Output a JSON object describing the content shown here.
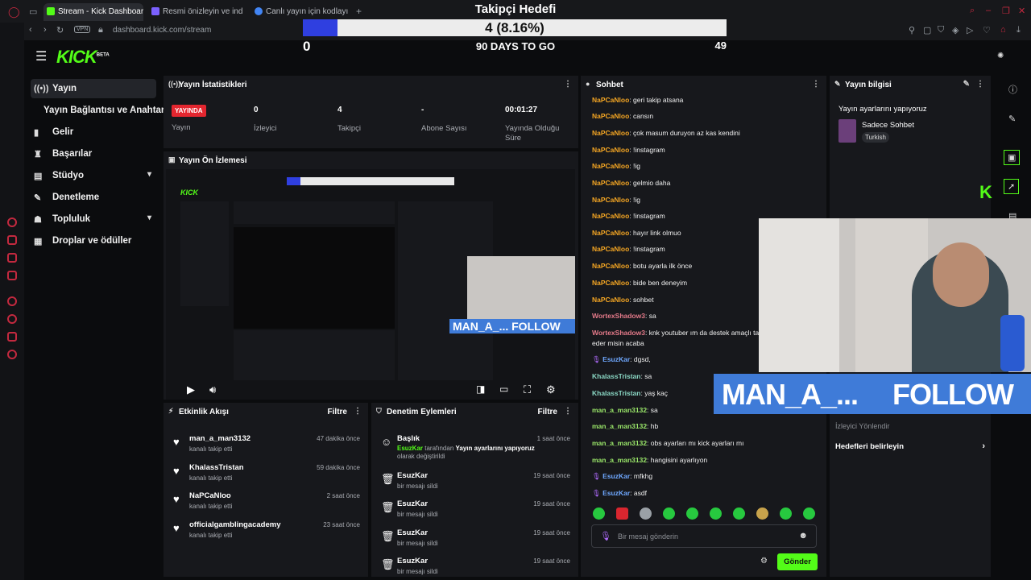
{
  "browser": {
    "tabs": [
      {
        "label": "Stream - Kick Dashboard",
        "color": "#53fc18"
      },
      {
        "label": "Resmi önizleyin ve indirin",
        "color": "#7b61ff"
      },
      {
        "label": "Canlı yayın için kodlayıcı a",
        "color": "#4285f4"
      }
    ],
    "new_tab": "+",
    "url": "dashboard.kick.com/stream",
    "vpn": "VPN"
  },
  "goal_overlay": {
    "title": "Takipçi Hedefi",
    "value_text": "4 (8.16%)",
    "progress_percent": 8.16,
    "min": "0",
    "days": "90 DAYS TO GO",
    "max": "49"
  },
  "app": {
    "logo": "KICK",
    "logo_badge": "BETA"
  },
  "sidebar": {
    "items": [
      {
        "label": "Yayın",
        "icon": "broadcast-icon",
        "active": true
      },
      {
        "label": "Yayın Bağlantısı ve Anahtarı",
        "icon": ""
      },
      {
        "label": "Gelir",
        "icon": "chart-icon"
      },
      {
        "label": "Başarılar",
        "icon": "trophy-icon"
      },
      {
        "label": "Stüdyo",
        "icon": "studio-icon",
        "chevron": true
      },
      {
        "label": "Denetleme",
        "icon": "wrench-icon"
      },
      {
        "label": "Topluluk",
        "icon": "community-icon",
        "chevron": true
      },
      {
        "label": "Droplar ve ödüller",
        "icon": "gift-icon"
      }
    ]
  },
  "stats_panel": {
    "title": "Yayın İstatistikleri",
    "live_badge": "YAYINDA",
    "items": [
      {
        "value": "",
        "label": "Yayın"
      },
      {
        "value": "0",
        "label": "İzleyici"
      },
      {
        "value": "4",
        "label": "Takipçi"
      },
      {
        "value": "-",
        "label": "Abone Sayısı"
      },
      {
        "value": "00:01:27",
        "label": "Yayında Olduğu Süre"
      }
    ]
  },
  "preview_panel": {
    "title": "Yayın Ön İzlemesi",
    "nested_banner": "MAN_A_...  FOLLOW"
  },
  "activity_panel": {
    "title": "Etkinlik Akışı",
    "filter": "Filtre",
    "items": [
      {
        "name": "man_a_man3132",
        "desc": "kanalı takip etti",
        "time": "47 dakika önce"
      },
      {
        "name": "KhalassTristan",
        "desc": "kanalı takip etti",
        "time": "59 dakika önce"
      },
      {
        "name": "NaPCaNloo",
        "desc": "kanalı takip etti",
        "time": "2 saat önce"
      },
      {
        "name": "officialgamblingacademy",
        "desc": "kanalı takip etti",
        "time": "23 saat önce"
      }
    ]
  },
  "moderation_panel": {
    "title": "Denetim Eylemleri",
    "filter": "Filtre",
    "first": {
      "name": "Başlık",
      "user": "EsuzKar",
      "mid": " tarafından ",
      "value": "Yayın ayarlarını yapıyoruz",
      "end": " olarak değiştirildi",
      "time": "1 saat önce"
    },
    "items": [
      {
        "name": "EsuzKar",
        "desc": "bir mesajı sildi",
        "time": "19 saat önce"
      },
      {
        "name": "EsuzKar",
        "desc": "bir mesajı sildi",
        "time": "19 saat önce"
      },
      {
        "name": "EsuzKar",
        "desc": "bir mesajı sildi",
        "time": "19 saat önce"
      },
      {
        "name": "EsuzKar",
        "desc": "bir mesajı sildi",
        "time": "19 saat önce"
      }
    ]
  },
  "chat_panel": {
    "title": "Sohbet",
    "messages": [
      {
        "user": "NaPCaNloo",
        "text": "geri takip atsana",
        "color": "#f5a623"
      },
      {
        "user": "NaPCaNloo",
        "text": "cansın",
        "color": "#f5a623"
      },
      {
        "user": "NaPCaNloo",
        "text": "çok masum duruyon az kas kendini",
        "color": "#f5a623"
      },
      {
        "user": "NaPCaNloo",
        "text": "!instagram",
        "color": "#f5a623"
      },
      {
        "user": "NaPCaNloo",
        "text": "!ig",
        "color": "#f5a623"
      },
      {
        "user": "NaPCaNloo",
        "text": "gelmio daha",
        "color": "#f5a623"
      },
      {
        "user": "NaPCaNloo",
        "text": "!ig",
        "color": "#f5a623"
      },
      {
        "user": "NaPCaNloo",
        "text": "!instagram",
        "color": "#f5a623"
      },
      {
        "user": "NaPCaNloo",
        "text": "hayır link olmuo",
        "color": "#f5a623"
      },
      {
        "user": "NaPCaNloo",
        "text": "!instagram",
        "color": "#f5a623"
      },
      {
        "user": "NaPCaNloo",
        "text": "botu ayarla ilk önce",
        "color": "#f5a623"
      },
      {
        "user": "NaPCaNloo",
        "text": "bide ben deneyim",
        "color": "#f5a623"
      },
      {
        "user": "NaPCaNloo",
        "text": "sohbet",
        "color": "#f5a623"
      },
      {
        "user": "WortexShadow3",
        "text": "sa",
        "color": "#e57a8a"
      },
      {
        "user": "WortexShadow3",
        "text": "knk youtuber ım da destek amaçlı takip eder misin acaba",
        "color": "#e57a8a"
      },
      {
        "user": "EsuzKar",
        "text": "dgsd,",
        "color": "#6fa8ff",
        "mic": true
      },
      {
        "user": "KhalassTristan",
        "text": "sa",
        "color": "#8ad7c4"
      },
      {
        "user": "KhalassTristan",
        "text": "yaş kaç",
        "color": "#8ad7c4"
      },
      {
        "user": "man_a_man3132",
        "text": "sa",
        "color": "#9be86a"
      },
      {
        "user": "man_a_man3132",
        "text": "hb",
        "color": "#9be86a"
      },
      {
        "user": "man_a_man3132",
        "text": "obs ayarları mı kick ayarları mı",
        "color": "#9be86a"
      },
      {
        "user": "man_a_man3132",
        "text": "hangisini ayarlıyon",
        "color": "#9be86a"
      },
      {
        "user": "EsuzKar",
        "text": "mfkhg",
        "color": "#6fa8ff",
        "mic": true
      },
      {
        "user": "EsuzKar",
        "text": "asdf",
        "color": "#6fa8ff",
        "mic": true
      }
    ],
    "placeholder": "Bir mesaj gönderin",
    "send": "Gönder"
  },
  "info_panel": {
    "title": "Yayın bilgisi",
    "stream_title": "Yayın ayarlarını yapıyoruz",
    "category": "Sadece Sohbet",
    "language": "Turkish",
    "redirect": "İzleyici Yönlendir",
    "goals": "Hedefleri belirleyin"
  },
  "follow_banner": {
    "name": "MAN_A_...",
    "action": "FOLLOW"
  },
  "colors": {
    "accent": "#53fc18",
    "live": "#e3262f",
    "banner": "#3f7bd8"
  }
}
